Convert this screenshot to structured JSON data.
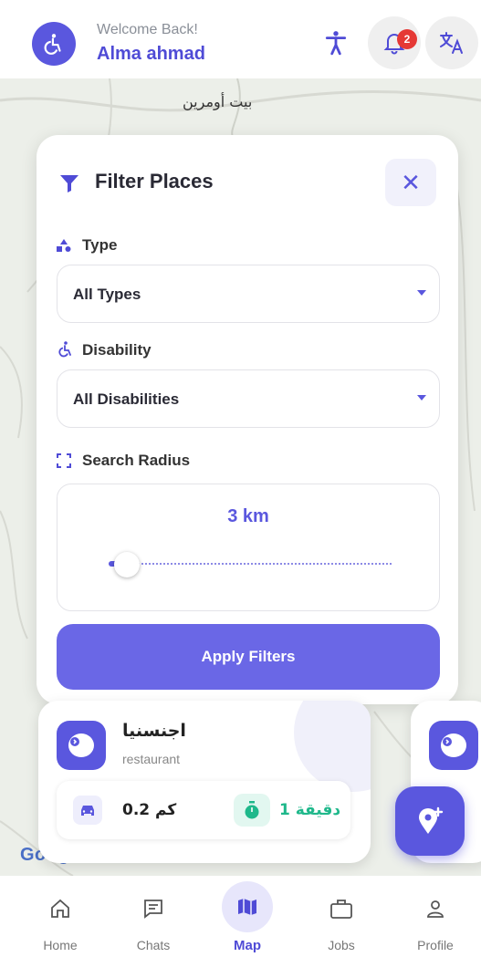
{
  "header": {
    "welcome": "Welcome Back!",
    "username": "Alma ahmad",
    "notification_count": "2"
  },
  "map": {
    "place_label": "بيت أومرين",
    "attribution": "Google"
  },
  "filter": {
    "title": "Filter Places",
    "type_label": "Type",
    "type_value": "All Types",
    "disability_label": "Disability",
    "disability_value": "All Disabilities",
    "radius_label": "Search Radius",
    "radius_value": "3 km",
    "radius_fraction": 0.03,
    "apply_label": "Apply Filters"
  },
  "place": {
    "name": "اجنسنيا",
    "type": "restaurant",
    "distance": "0.2 كم",
    "time": "1 دقيقة"
  },
  "nav": {
    "home": "Home",
    "chats": "Chats",
    "map": "Map",
    "jobs": "Jobs",
    "profile": "Profile"
  },
  "colors": {
    "accent": "#5a57de",
    "time_green": "#1fb88b",
    "badge_red": "#e53935"
  }
}
